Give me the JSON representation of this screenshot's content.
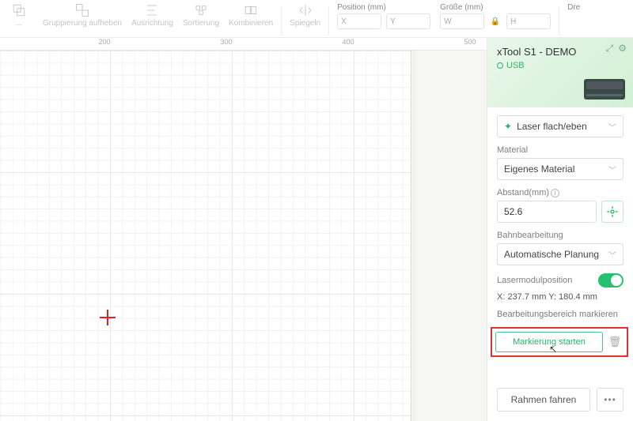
{
  "toolbar": {
    "group_btn": "...",
    "ungroup": "Gruppierung aufheben",
    "align": "Ausrichtung",
    "sort": "Sortierung",
    "combine": "Kombinieren",
    "mirror": "Spiegeln",
    "position": {
      "label": "Position (mm)",
      "x": "X",
      "y": "Y"
    },
    "size": {
      "label": "Größe (mm)",
      "w": "W",
      "h": "H"
    },
    "rotate_label": "Dre"
  },
  "ruler": {
    "t200": "200",
    "t300": "300",
    "t400": "400",
    "t500": "500"
  },
  "device": {
    "name": "xTool S1 - DEMO",
    "conn": "USB"
  },
  "side": {
    "laser_mode": "Laser flach/eben",
    "material_label": "Material",
    "material_value": "Eigenes Material",
    "distance_label": "Abstand(mm)",
    "distance_value": "52.6",
    "path_label": "Bahnbearbeitung",
    "path_value": "Automatische Planung",
    "module_label": "Lasermodulposition",
    "coords": "X: 237.7 mm   Y: 180.4 mm",
    "mark_label": "Bearbeitungsbereich markieren",
    "mark_button": "Markierung starten",
    "frame_button": "Rahmen fahren",
    "more": "•••"
  }
}
